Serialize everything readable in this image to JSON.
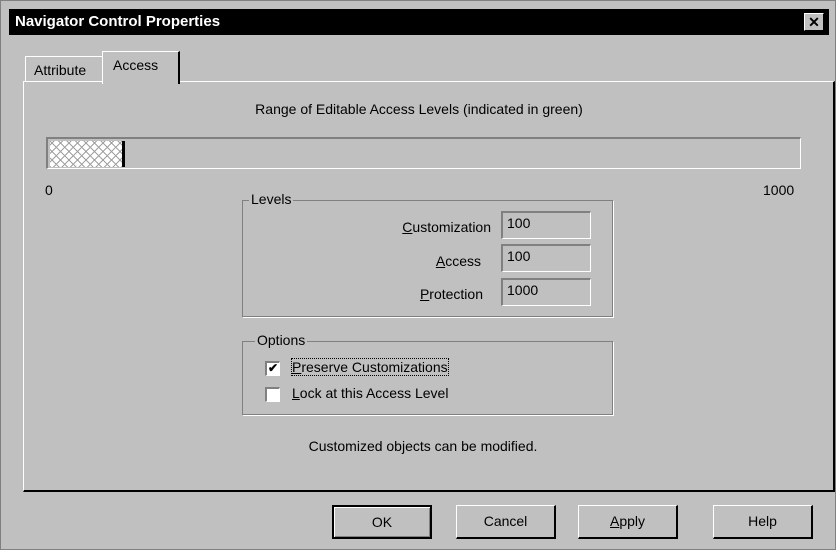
{
  "window": {
    "title": "Navigator Control Properties",
    "close_glyph": "✕"
  },
  "tabs": [
    {
      "label": "Attribute"
    },
    {
      "label": "Access",
      "selected": true
    }
  ],
  "range": {
    "label": "Range of Editable Access Levels (indicated in green)",
    "min_label": "0",
    "max_label": "1000",
    "fill_fraction": 0.1
  },
  "levels": {
    "group_label": "Levels",
    "customization": {
      "label_pre": "",
      "label_mn": "C",
      "label_post": "ustomization",
      "value": "100"
    },
    "access": {
      "label_pre": "",
      "label_mn": "A",
      "label_post": "ccess",
      "value": "100"
    },
    "protection": {
      "label_pre": "",
      "label_mn": "P",
      "label_post": "rotection",
      "value": "1000"
    }
  },
  "options": {
    "group_label": "Options",
    "preserve": {
      "label_mn": "P",
      "label_post": "reserve Customizations",
      "checked": true
    },
    "lock": {
      "label_mn": "L",
      "label_post": "ock at this Access Level",
      "checked": false
    }
  },
  "status_text": "Customized objects can be modified.",
  "buttons": {
    "ok": {
      "label": "OK"
    },
    "cancel": {
      "label": "Cancel"
    },
    "apply": {
      "mn": "A",
      "rest": "pply"
    },
    "help": {
      "label": "Help"
    }
  }
}
